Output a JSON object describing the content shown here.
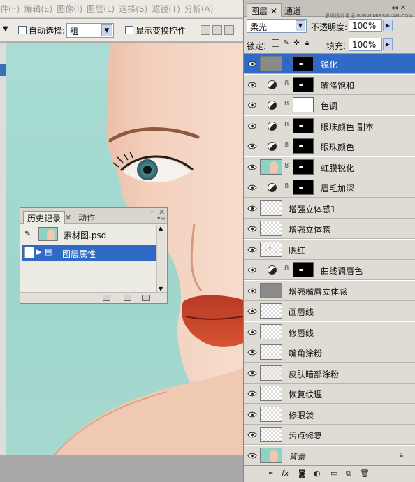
{
  "menubar": {
    "items": [
      "件(F)",
      "编辑(E)",
      "图像(I)",
      "图层(L)",
      "选择(S)",
      "滤镜(T)",
      "分析(A)"
    ]
  },
  "options": {
    "auto_select_label": "自动选择:",
    "auto_select_value": "组",
    "show_transform_label": "显示变换控件"
  },
  "history": {
    "tabs": [
      "历史记录",
      "动作"
    ],
    "snapshot_label": "素材图.psd",
    "step_label": "图层属性"
  },
  "layers": {
    "tabs": [
      "图层",
      "通道"
    ],
    "watermark": "思缘设计论坛 WWW.MISSYUAN.COM",
    "blend_mode": "柔光",
    "opacity_label": "不透明度:",
    "opacity_value": "100%",
    "lock_label": "锁定:",
    "fill_label": "填充:",
    "fill_value": "100%",
    "items": [
      {
        "name": "锐化",
        "kind": "gray-mask",
        "selected": true
      },
      {
        "name": "嘴降饱和",
        "kind": "adj-mask"
      },
      {
        "name": "色调",
        "kind": "adj-white"
      },
      {
        "name": "眼珠颜色 副本",
        "kind": "adj-mask"
      },
      {
        "name": "眼珠颜色",
        "kind": "adj-mask"
      },
      {
        "name": "虹膜锐化",
        "kind": "photo-mask"
      },
      {
        "name": "眉毛加深",
        "kind": "adj-mask"
      },
      {
        "name": "增强立体感1",
        "kind": "trans"
      },
      {
        "name": "增强立体感",
        "kind": "trans"
      },
      {
        "name": "腮红",
        "kind": "pinkdots"
      },
      {
        "name": "曲线调唇色",
        "kind": "adj-mask"
      },
      {
        "name": "增强嘴唇立体感",
        "kind": "gray"
      },
      {
        "name": "画唇线",
        "kind": "trans"
      },
      {
        "name": "修唇线",
        "kind": "trans"
      },
      {
        "name": "嘴角涂粉",
        "kind": "trans"
      },
      {
        "name": "皮肤暗部涂粉",
        "kind": "pink"
      },
      {
        "name": "恢复纹理",
        "kind": "trans"
      },
      {
        "name": "修眼袋",
        "kind": "trans"
      },
      {
        "name": "污点修复",
        "kind": "trans"
      },
      {
        "name": "背景",
        "kind": "photo"
      }
    ]
  }
}
